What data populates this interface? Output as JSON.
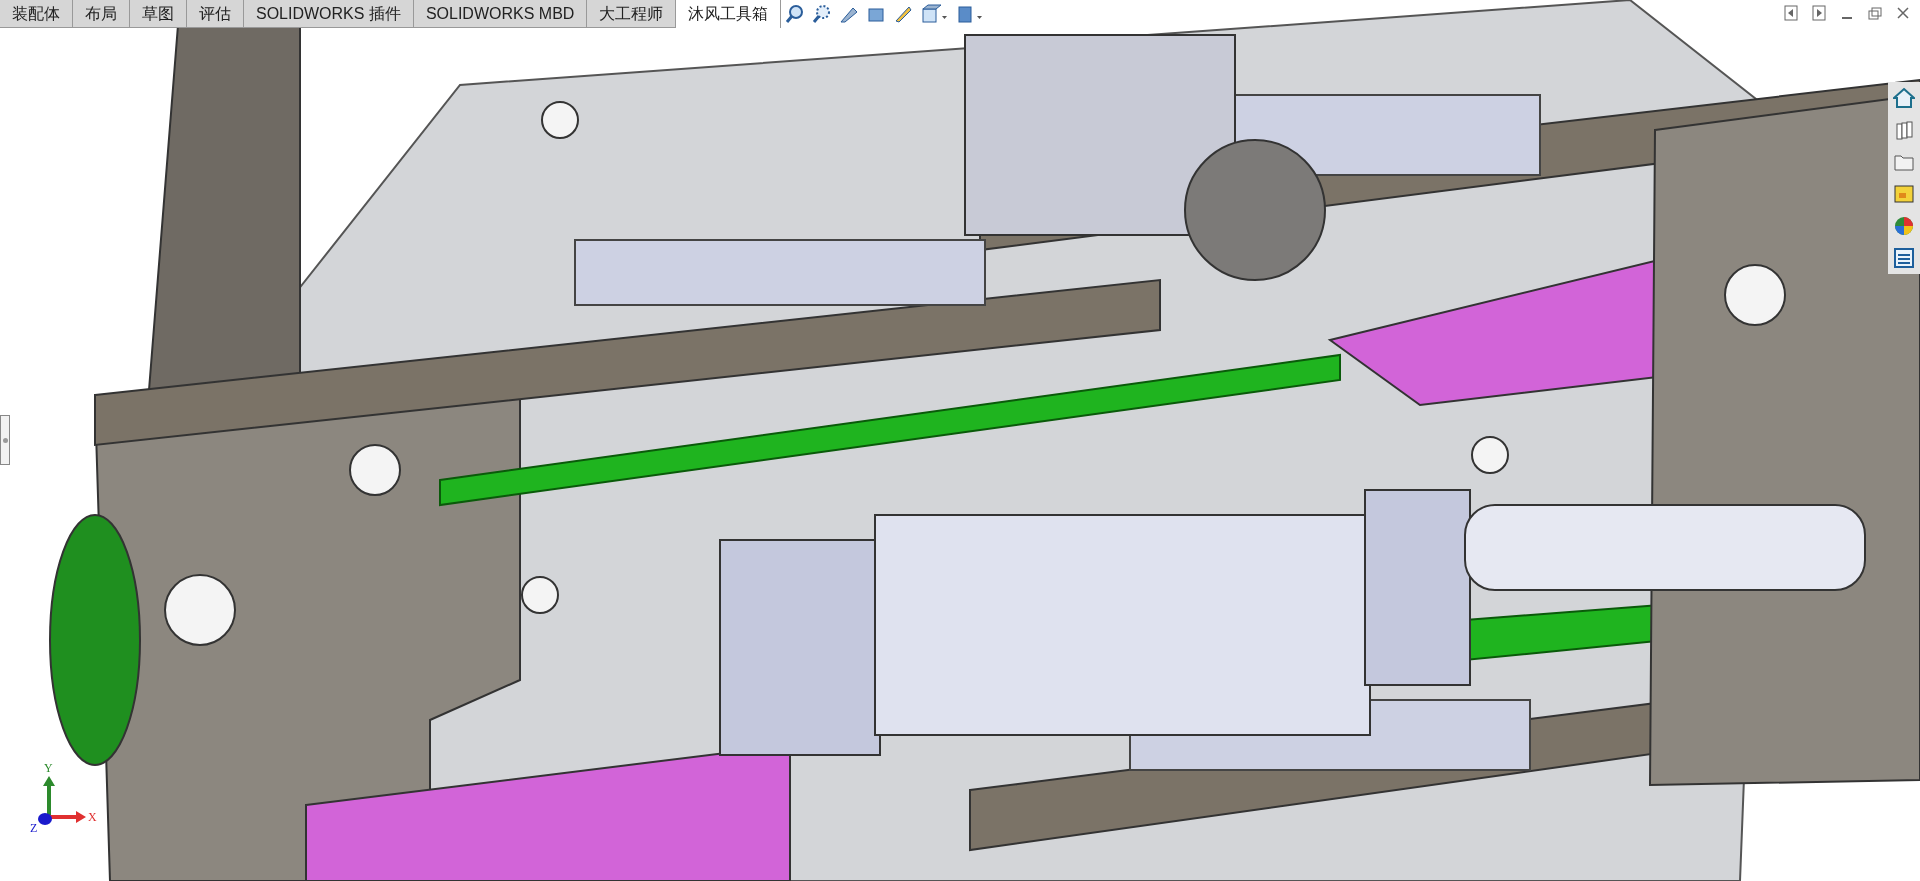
{
  "tabs": [
    {
      "label": "装配体",
      "selected": false
    },
    {
      "label": "布局",
      "selected": false
    },
    {
      "label": "草图",
      "selected": false
    },
    {
      "label": "评估",
      "selected": false
    },
    {
      "label": "SOLIDWORKS 插件",
      "selected": false
    },
    {
      "label": "SOLIDWORKS MBD",
      "selected": false
    },
    {
      "label": "大工程师",
      "selected": false
    },
    {
      "label": "沐风工具箱",
      "selected": true
    }
  ],
  "triad": {
    "x": "X",
    "y": "Y",
    "z": "Z"
  }
}
